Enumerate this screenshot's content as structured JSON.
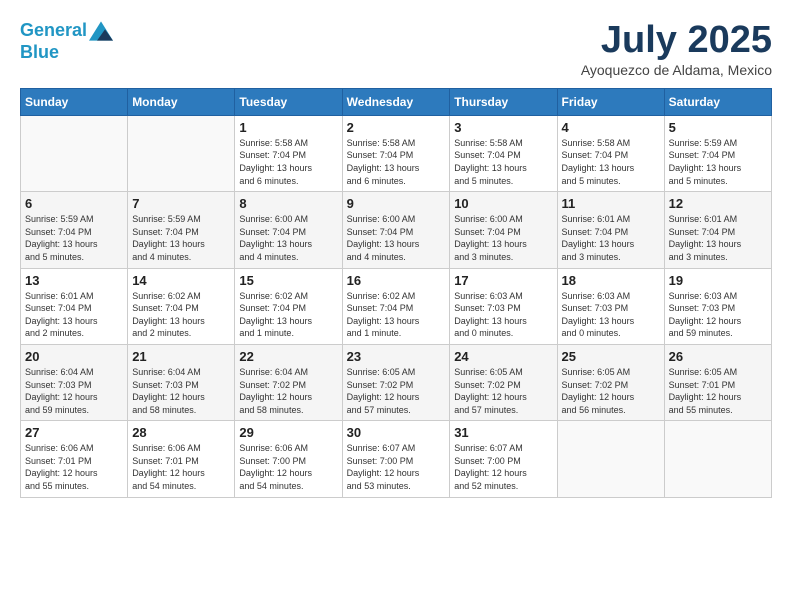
{
  "header": {
    "logo_line1": "General",
    "logo_line2": "Blue",
    "month": "July 2025",
    "location": "Ayoquezco de Aldama, Mexico"
  },
  "weekdays": [
    "Sunday",
    "Monday",
    "Tuesday",
    "Wednesday",
    "Thursday",
    "Friday",
    "Saturday"
  ],
  "weeks": [
    [
      {
        "day": "",
        "info": ""
      },
      {
        "day": "",
        "info": ""
      },
      {
        "day": "1",
        "info": "Sunrise: 5:58 AM\nSunset: 7:04 PM\nDaylight: 13 hours\nand 6 minutes."
      },
      {
        "day": "2",
        "info": "Sunrise: 5:58 AM\nSunset: 7:04 PM\nDaylight: 13 hours\nand 6 minutes."
      },
      {
        "day": "3",
        "info": "Sunrise: 5:58 AM\nSunset: 7:04 PM\nDaylight: 13 hours\nand 5 minutes."
      },
      {
        "day": "4",
        "info": "Sunrise: 5:58 AM\nSunset: 7:04 PM\nDaylight: 13 hours\nand 5 minutes."
      },
      {
        "day": "5",
        "info": "Sunrise: 5:59 AM\nSunset: 7:04 PM\nDaylight: 13 hours\nand 5 minutes."
      }
    ],
    [
      {
        "day": "6",
        "info": "Sunrise: 5:59 AM\nSunset: 7:04 PM\nDaylight: 13 hours\nand 5 minutes."
      },
      {
        "day": "7",
        "info": "Sunrise: 5:59 AM\nSunset: 7:04 PM\nDaylight: 13 hours\nand 4 minutes."
      },
      {
        "day": "8",
        "info": "Sunrise: 6:00 AM\nSunset: 7:04 PM\nDaylight: 13 hours\nand 4 minutes."
      },
      {
        "day": "9",
        "info": "Sunrise: 6:00 AM\nSunset: 7:04 PM\nDaylight: 13 hours\nand 4 minutes."
      },
      {
        "day": "10",
        "info": "Sunrise: 6:00 AM\nSunset: 7:04 PM\nDaylight: 13 hours\nand 3 minutes."
      },
      {
        "day": "11",
        "info": "Sunrise: 6:01 AM\nSunset: 7:04 PM\nDaylight: 13 hours\nand 3 minutes."
      },
      {
        "day": "12",
        "info": "Sunrise: 6:01 AM\nSunset: 7:04 PM\nDaylight: 13 hours\nand 3 minutes."
      }
    ],
    [
      {
        "day": "13",
        "info": "Sunrise: 6:01 AM\nSunset: 7:04 PM\nDaylight: 13 hours\nand 2 minutes."
      },
      {
        "day": "14",
        "info": "Sunrise: 6:02 AM\nSunset: 7:04 PM\nDaylight: 13 hours\nand 2 minutes."
      },
      {
        "day": "15",
        "info": "Sunrise: 6:02 AM\nSunset: 7:04 PM\nDaylight: 13 hours\nand 1 minute."
      },
      {
        "day": "16",
        "info": "Sunrise: 6:02 AM\nSunset: 7:04 PM\nDaylight: 13 hours\nand 1 minute."
      },
      {
        "day": "17",
        "info": "Sunrise: 6:03 AM\nSunset: 7:03 PM\nDaylight: 13 hours\nand 0 minutes."
      },
      {
        "day": "18",
        "info": "Sunrise: 6:03 AM\nSunset: 7:03 PM\nDaylight: 13 hours\nand 0 minutes."
      },
      {
        "day": "19",
        "info": "Sunrise: 6:03 AM\nSunset: 7:03 PM\nDaylight: 12 hours\nand 59 minutes."
      }
    ],
    [
      {
        "day": "20",
        "info": "Sunrise: 6:04 AM\nSunset: 7:03 PM\nDaylight: 12 hours\nand 59 minutes."
      },
      {
        "day": "21",
        "info": "Sunrise: 6:04 AM\nSunset: 7:03 PM\nDaylight: 12 hours\nand 58 minutes."
      },
      {
        "day": "22",
        "info": "Sunrise: 6:04 AM\nSunset: 7:02 PM\nDaylight: 12 hours\nand 58 minutes."
      },
      {
        "day": "23",
        "info": "Sunrise: 6:05 AM\nSunset: 7:02 PM\nDaylight: 12 hours\nand 57 minutes."
      },
      {
        "day": "24",
        "info": "Sunrise: 6:05 AM\nSunset: 7:02 PM\nDaylight: 12 hours\nand 57 minutes."
      },
      {
        "day": "25",
        "info": "Sunrise: 6:05 AM\nSunset: 7:02 PM\nDaylight: 12 hours\nand 56 minutes."
      },
      {
        "day": "26",
        "info": "Sunrise: 6:05 AM\nSunset: 7:01 PM\nDaylight: 12 hours\nand 55 minutes."
      }
    ],
    [
      {
        "day": "27",
        "info": "Sunrise: 6:06 AM\nSunset: 7:01 PM\nDaylight: 12 hours\nand 55 minutes."
      },
      {
        "day": "28",
        "info": "Sunrise: 6:06 AM\nSunset: 7:01 PM\nDaylight: 12 hours\nand 54 minutes."
      },
      {
        "day": "29",
        "info": "Sunrise: 6:06 AM\nSunset: 7:00 PM\nDaylight: 12 hours\nand 54 minutes."
      },
      {
        "day": "30",
        "info": "Sunrise: 6:07 AM\nSunset: 7:00 PM\nDaylight: 12 hours\nand 53 minutes."
      },
      {
        "day": "31",
        "info": "Sunrise: 6:07 AM\nSunset: 7:00 PM\nDaylight: 12 hours\nand 52 minutes."
      },
      {
        "day": "",
        "info": ""
      },
      {
        "day": "",
        "info": ""
      }
    ]
  ]
}
